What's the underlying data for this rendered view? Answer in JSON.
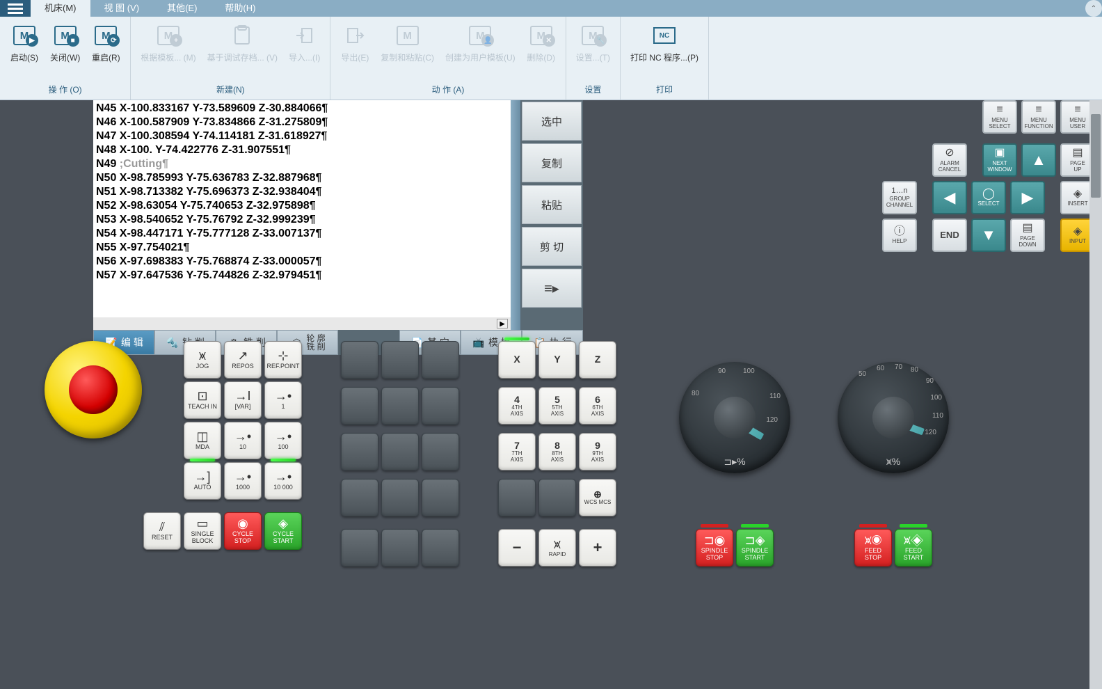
{
  "menubar": {
    "tabs": [
      {
        "label": "机床(M)",
        "active": true
      },
      {
        "label": "视 图 (V)"
      },
      {
        "label": "其他(E)"
      },
      {
        "label": "帮助(H)"
      }
    ]
  },
  "ribbon": {
    "groups": [
      {
        "label": "操 作 (O)",
        "items": [
          {
            "label": "启动(S)",
            "icon": "M-play"
          },
          {
            "label": "关闭(W)",
            "icon": "M-stop"
          },
          {
            "label": "重启(R)",
            "icon": "M-refresh"
          }
        ]
      },
      {
        "label": "新建(N)",
        "items": [
          {
            "label": "根据模板... (M)",
            "icon": "M-plus",
            "disabled": true
          },
          {
            "label": "基于调试存档... (V)",
            "icon": "doc",
            "disabled": true
          },
          {
            "label": "导入...(I)",
            "icon": "import",
            "disabled": true
          }
        ]
      },
      {
        "label": "动 作 (A)",
        "items": [
          {
            "label": "导出(E)",
            "icon": "export",
            "disabled": true
          },
          {
            "label": "复制和粘贴(C)",
            "icon": "M-copy",
            "disabled": true
          },
          {
            "label": "创建为用户模板(U)",
            "icon": "M-user",
            "disabled": true
          },
          {
            "label": "删除(D)",
            "icon": "M-x",
            "disabled": true
          }
        ]
      },
      {
        "label": "设置",
        "items": [
          {
            "label": "设置...(T)",
            "icon": "M-gear",
            "disabled": true
          }
        ]
      },
      {
        "label": "打印",
        "items": [
          {
            "label": "打印 NC 程序...(P)",
            "icon": "NC"
          }
        ]
      }
    ]
  },
  "code": [
    "N45 X-100.833167 Y-73.589609 Z-30.884066¶",
    "N46 X-100.587909 Y-73.834866 Z-31.275809¶",
    "N47 X-100.308594 Y-74.114181 Z-31.618927¶",
    "N48 X-100. Y-74.422776 Z-31.907551¶",
    "N49 ;Cutting¶",
    "N50 X-98.785993 Y-75.636783 Z-32.887968¶",
    "N51 X-98.713382 Y-75.696373 Z-32.938404¶",
    "N52 X-98.63054 Y-75.740653 Z-32.975898¶",
    "N53 X-98.540652 Y-75.76792 Z-32.999239¶",
    "N54 X-98.447171 Y-75.777128 Z-33.007137¶",
    "N55 X-97.754021¶",
    "N56 X-97.698383 Y-75.768874 Z-33.000057¶",
    "N57 X-97.647536 Y-75.744826 Z-32.979451¶"
  ],
  "sideButtons": [
    "选中",
    "复制",
    "粘贴",
    "剪 切"
  ],
  "editTabs": [
    {
      "label": "编 辑",
      "active": true
    },
    {
      "label": "钻 削"
    },
    {
      "label": "铣 削"
    },
    {
      "label": "轮 廓\n铣 削"
    },
    {
      "label": "其 它"
    },
    {
      "label": "模 拟"
    },
    {
      "label": "执 行"
    }
  ],
  "navPanel": {
    "row0": [
      "MENU\nSELECT",
      "MENU\nFUNCTION",
      "MENU\nUSER"
    ],
    "row1": [
      {
        "label": "ALARM\nCANCEL",
        "ico": "⊘"
      },
      {
        "label": "NEXT\nWINDOW",
        "ico": "▣",
        "teal": true
      },
      {
        "label": "▲",
        "teal": true,
        "arrow": true
      },
      {
        "label": "PAGE\nUP",
        "ico": "▤"
      }
    ],
    "row2": [
      {
        "label": "GROUP\nCHANNEL",
        "ico": "1…n"
      },
      {
        "label": "◀",
        "teal": true,
        "arrow": true
      },
      {
        "label": "SELECT",
        "ico": "◯",
        "teal": true
      },
      {
        "label": "▶",
        "teal": true,
        "arrow": true
      },
      {
        "label": "INSERT",
        "ico": "◈"
      }
    ],
    "row3": [
      {
        "label": "HELP",
        "ico": "ⓘ"
      },
      {
        "label": "END",
        "end": true
      },
      {
        "label": "▼",
        "teal": true,
        "arrow": true
      },
      {
        "label": "PAGE\nDOWN",
        "ico": "▤"
      },
      {
        "label": "INPUT",
        "ico": "◈",
        "yellow": true
      }
    ]
  },
  "modeKeys": [
    [
      {
        "l": "JOG",
        "i": "⩙"
      },
      {
        "l": "REPOS",
        "i": "↗"
      },
      {
        "l": "REF.POINT",
        "i": "⊹"
      }
    ],
    [
      {
        "l": "TEACH IN",
        "i": "⊡"
      },
      {
        "l": "[VAR]",
        "i": "→I"
      },
      {
        "l": "1",
        "i": "→•"
      }
    ],
    [
      {
        "l": "MDA",
        "i": "◫"
      },
      {
        "l": "10",
        "i": "→•"
      },
      {
        "l": "100",
        "i": "→•"
      }
    ],
    [
      {
        "l": "AUTO",
        "i": "→]",
        "led": "on"
      },
      {
        "l": "1000",
        "i": "→•"
      },
      {
        "l": "10 000",
        "i": "→•",
        "led": "on"
      }
    ]
  ],
  "ctrlKeys": [
    {
      "l": "RESET",
      "i": "⫽"
    },
    {
      "l": "SINGLE\nBLOCK",
      "i": "▭"
    },
    {
      "l": "CYCLE\nSTOP",
      "i": "◉",
      "cls": "red"
    },
    {
      "l": "CYCLE\nSTART",
      "i": "◈",
      "cls": "green"
    }
  ],
  "axisKeys": [
    [
      {
        "m": "X",
        "led": "on"
      },
      {
        "m": "Y"
      },
      {
        "m": "Z"
      }
    ],
    [
      {
        "m": "4",
        "s": "4TH\nAXIS"
      },
      {
        "m": "5",
        "s": "5TH\nAXIS"
      },
      {
        "m": "6",
        "s": "6TH\nAXIS"
      }
    ],
    [
      {
        "m": "7",
        "s": "7TH\nAXIS"
      },
      {
        "m": "8",
        "s": "8TH\nAXIS"
      },
      {
        "m": "9",
        "s": "9TH\nAXIS"
      }
    ],
    [
      {
        "blank": true
      },
      {
        "blank": true
      },
      {
        "m": "⊕",
        "s": "WCS MCS"
      }
    ]
  ],
  "bottomAxis": [
    {
      "m": "−"
    },
    {
      "m": "⩙",
      "s": "RAPID"
    },
    {
      "m": "+"
    }
  ],
  "dials": [
    {
      "label": "⊐▸%",
      "ticks": [
        "80",
        "90",
        "100",
        "110",
        "120"
      ]
    },
    {
      "label": "⩙%",
      "ticks": [
        "50",
        "60",
        "70",
        "80",
        "90",
        "100",
        "110",
        "120"
      ]
    }
  ],
  "spindleFeed": [
    [
      {
        "l": "SPINDLE\nSTOP",
        "cls": "red",
        "i": "⊐◉"
      },
      {
        "l": "SPINDLE\nSTART",
        "cls": "green",
        "i": "⊐◈"
      }
    ],
    [
      {
        "l": "FEED\nSTOP",
        "cls": "red",
        "i": "⩙◉"
      },
      {
        "l": "FEED\nSTART",
        "cls": "green",
        "i": "⩙◈"
      }
    ]
  ]
}
